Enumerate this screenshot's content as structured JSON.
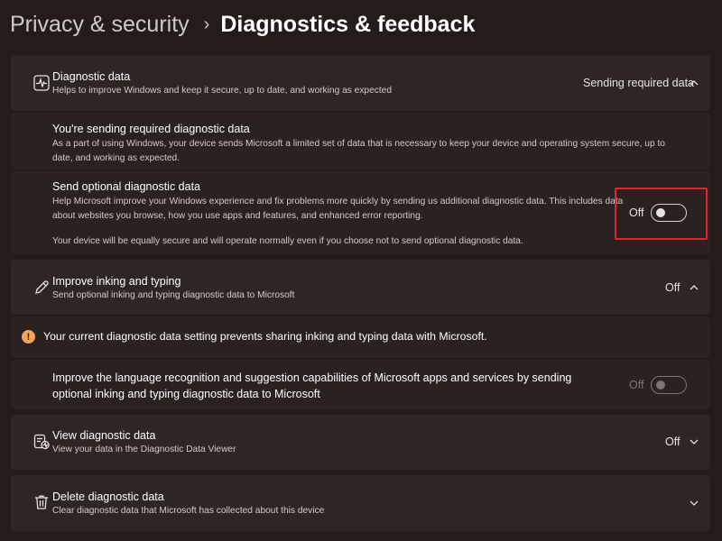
{
  "header": {
    "parent": "Privacy & security",
    "separator": "›",
    "current": "Diagnostics & feedback"
  },
  "diagnostic_data": {
    "title": "Diagnostic data",
    "description": "Helps to improve Windows and keep it secure, up to date, and working as expected",
    "status": "Sending required data",
    "icon": "pulse-icon",
    "expanded": true
  },
  "required_data": {
    "title": "You're sending required diagnostic data",
    "description": "As a part of using Windows, your device sends Microsoft a limited set of data that is necessary to keep your device and operating system secure, up to date, and working as expected."
  },
  "optional_data": {
    "title": "Send optional diagnostic data",
    "description": "Help Microsoft improve your Windows experience and fix problems more quickly by sending us additional diagnostic data. This includes data about websites you browse, how you use apps and features, and enhanced error reporting.",
    "note": "Your device will be equally secure and will operate normally even if you choose not to send optional diagnostic data.",
    "toggle_label": "Off",
    "toggle_on": false
  },
  "inking": {
    "title": "Improve inking and typing",
    "description": "Send optional inking and typing diagnostic data to Microsoft",
    "status": "Off",
    "icon": "pen-icon",
    "expanded": true
  },
  "inking_warning": {
    "text": "Your current diagnostic data setting prevents sharing inking and typing data with Microsoft.",
    "icon": "info-icon",
    "icon_glyph": "!",
    "color": "#f3a35c"
  },
  "language_recognition": {
    "text": "Improve the language recognition and suggestion capabilities of Microsoft apps and services by sending optional inking and typing diagnostic data to Microsoft",
    "toggle_label": "Off",
    "toggle_on": false,
    "disabled": true
  },
  "view_data": {
    "title": "View diagnostic data",
    "description": "View your data in the Diagnostic Data Viewer",
    "status": "Off",
    "icon": "data-viewer-icon",
    "expanded": false
  },
  "delete_data": {
    "title": "Delete diagnostic data",
    "description": "Clear diagnostic data that Microsoft has collected about this device",
    "icon": "trash-icon",
    "expanded": false
  },
  "colors": {
    "background": "#231c1b",
    "card": "#2e2625",
    "highlight": "#e0252c"
  }
}
